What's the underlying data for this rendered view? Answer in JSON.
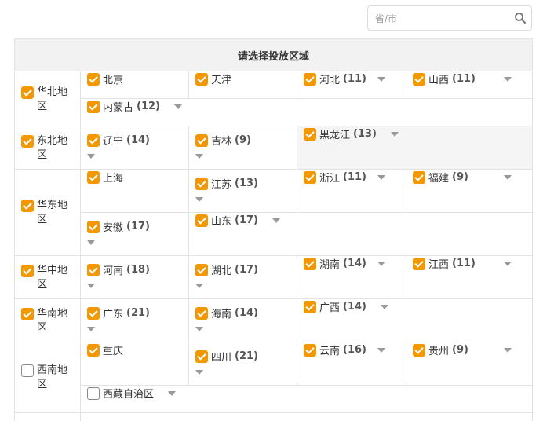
{
  "search": {
    "placeholder": "省/市"
  },
  "table": {
    "header": "请选择投放区域"
  },
  "regions": {
    "huabei": {
      "label": "华北地区",
      "provinces": [
        {
          "name": "北京",
          "count": ""
        },
        {
          "name": "天津",
          "count": ""
        },
        {
          "name": "河北",
          "count": "(11)"
        },
        {
          "name": "山西",
          "count": "(11)"
        },
        {
          "name": "内蒙古",
          "count": "(12)"
        }
      ]
    },
    "dongbei": {
      "label": "东北地区",
      "provinces": [
        {
          "name": "辽宁",
          "count": "(14)"
        },
        {
          "name": "吉林",
          "count": "(9)"
        },
        {
          "name": "黑龙江",
          "count": "(13)"
        }
      ]
    },
    "huadong": {
      "label": "华东地区",
      "provinces": [
        {
          "name": "上海",
          "count": ""
        },
        {
          "name": "江苏",
          "count": "(13)"
        },
        {
          "name": "浙江",
          "count": "(11)"
        },
        {
          "name": "福建",
          "count": "(9)"
        },
        {
          "name": "安徽",
          "count": "(17)"
        },
        {
          "name": "山东",
          "count": "(17)"
        }
      ]
    },
    "huazhong": {
      "label": "华中地区",
      "provinces": [
        {
          "name": "河南",
          "count": "(18)"
        },
        {
          "name": "湖北",
          "count": "(17)"
        },
        {
          "name": "湖南",
          "count": "(14)"
        },
        {
          "name": "江西",
          "count": "(11)"
        }
      ]
    },
    "huanan": {
      "label": "华南地区",
      "provinces": [
        {
          "name": "广东",
          "count": "(21)"
        },
        {
          "name": "海南",
          "count": "(14)"
        },
        {
          "name": "广西",
          "count": "(14)"
        }
      ]
    },
    "xinan": {
      "label": "西南地区",
      "provinces": [
        {
          "name": "重庆",
          "count": ""
        },
        {
          "name": "四川",
          "count": "(21)"
        },
        {
          "name": "云南",
          "count": "(16)"
        },
        {
          "name": "贵州",
          "count": "(9)"
        },
        {
          "name": "西藏自治区",
          "count": ""
        }
      ]
    }
  },
  "colors": {
    "accent": "#f39800",
    "header_bg": "#f2f2f2",
    "border": "#e3e3e3"
  },
  "icons": {
    "search": "search-icon",
    "checkbox_checked": "checkbox-checked",
    "expand": "caret-down-icon"
  }
}
